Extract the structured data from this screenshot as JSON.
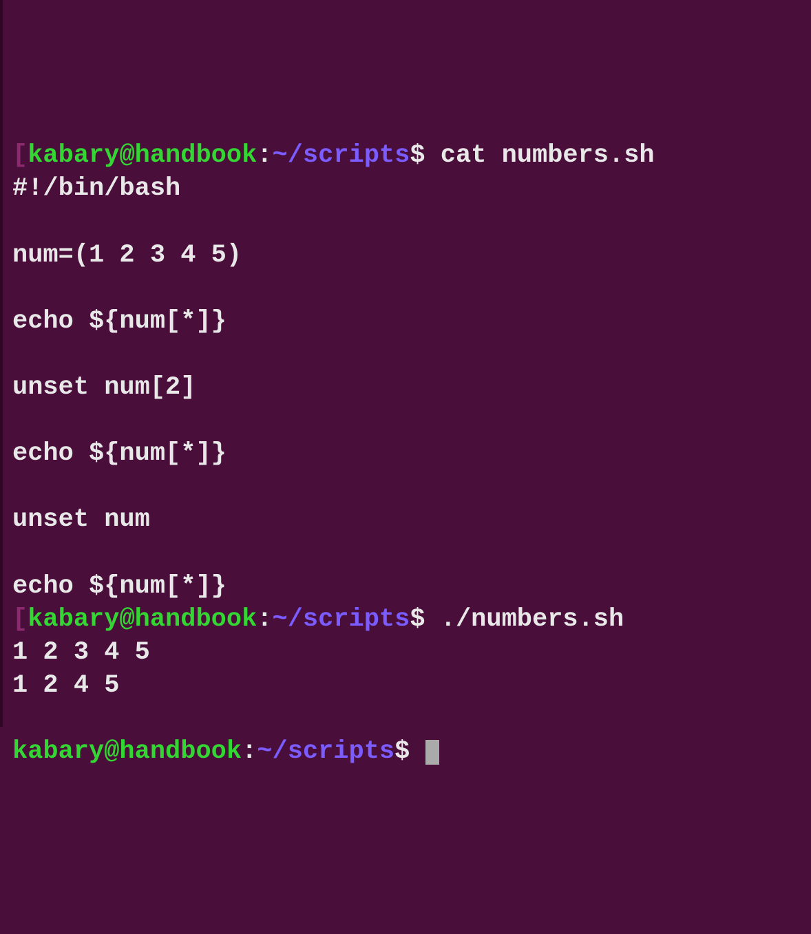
{
  "prompt": {
    "openBracket": "[",
    "user": "kabary@handbook",
    "colon": ":",
    "path": "~/scripts",
    "dollar": "$ "
  },
  "lines": {
    "cmd1": "cat numbers.sh",
    "l01": "#!/bin/bash",
    "l02": "",
    "l03": "num=(1 2 3 4 5)",
    "l04": "",
    "l05": "echo ${num[*]}",
    "l06": "",
    "l07": "unset num[2]",
    "l08": "",
    "l09": "echo ${num[*]}",
    "l10": "",
    "l11": "unset num",
    "l12": "",
    "l13": "echo ${num[*]}",
    "cmd2": "./numbers.sh",
    "out1": "1 2 3 4 5",
    "out2": "1 2 4 5",
    "out3": ""
  }
}
